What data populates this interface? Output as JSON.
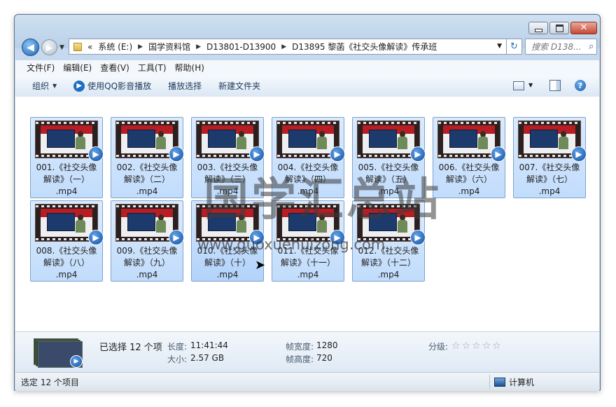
{
  "window": {
    "controls": {
      "minimize": "",
      "maximize": "",
      "close": "✕"
    }
  },
  "nav": {
    "back_icon": "back-arrow-icon",
    "forward_icon": "forward-arrow-icon"
  },
  "address": {
    "prefix": "«",
    "crumbs": [
      "系统 (E:)",
      "国学资料馆",
      "D13801-D13900",
      "D13895 黎菡《社交头像解读》传承班"
    ],
    "separator": "▶"
  },
  "search": {
    "placeholder": "搜索 D138..."
  },
  "menu": [
    "文件(F)",
    "编辑(E)",
    "查看(V)",
    "工具(T)",
    "帮助(H)"
  ],
  "toolbar": {
    "organize": "组织",
    "play_qq": "使用QQ影音播放",
    "play_selection": "播放选择",
    "new_folder": "新建文件夹"
  },
  "files": [
    {
      "line1": "001.《社交头像",
      "line2": "解读》（一）",
      "line3": ".mp4"
    },
    {
      "line1": "002.《社交头像",
      "line2": "解读》（二）",
      "line3": ".mp4"
    },
    {
      "line1": "003.《社交头像",
      "line2": "解读》（三）",
      "line3": ".mp4"
    },
    {
      "line1": "004.《社交头像",
      "line2": "解读》（四）",
      "line3": ".mp4"
    },
    {
      "line1": "005.《社交头像",
      "line2": "解读》（五）",
      "line3": ".mp4"
    },
    {
      "line1": "006.《社交头像",
      "line2": "解读》（六）",
      "line3": ".mp4"
    },
    {
      "line1": "007.《社交头像",
      "line2": "解读》（七）",
      "line3": ".mp4"
    },
    {
      "line1": "008.《社交头像",
      "line2": "解读》（八）",
      "line3": ".mp4"
    },
    {
      "line1": "009.《社交头像",
      "line2": "解读》（九）",
      "line3": ".mp4"
    },
    {
      "line1": "010.《社交头像",
      "line2": "解读》（十）",
      "line3": ".mp4"
    },
    {
      "line1": "011.《社交头像",
      "line2": "解读》（十一）",
      "line3": ".mp4"
    },
    {
      "line1": "012.《社交头像",
      "line2": "解读》（十二）",
      "line3": ".mp4"
    }
  ],
  "watermark": {
    "text": "国学汇总站",
    "url": "www.guoxuehuizong.com"
  },
  "details": {
    "selected": "已选择 12 个项",
    "length_label": "长度:",
    "length_value": "11:41:44",
    "size_label": "大小:",
    "size_value": "2.57 GB",
    "frame_width_label": "帧宽度:",
    "frame_width_value": "1280",
    "frame_height_label": "帧高度:",
    "frame_height_value": "720",
    "rating_label": "分级:",
    "rating_value": 0,
    "rating_max": 5
  },
  "status": {
    "left": "选定 12 个项目",
    "right": "计算机"
  }
}
